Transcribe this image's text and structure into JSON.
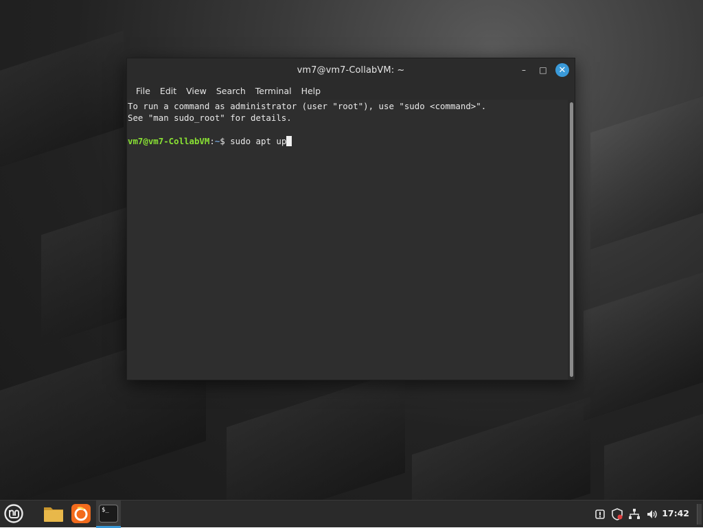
{
  "window": {
    "title": "vm7@vm7-CollabVM: ~",
    "minimize_glyph": "–",
    "maximize_glyph": "□",
    "close_glyph": "✕"
  },
  "menubar": {
    "items": [
      {
        "label": "File"
      },
      {
        "label": "Edit"
      },
      {
        "label": "View"
      },
      {
        "label": "Search"
      },
      {
        "label": "Terminal"
      },
      {
        "label": "Help"
      }
    ]
  },
  "terminal": {
    "lines": [
      "To run a command as administrator (user \"root\"), use \"sudo <command>\".",
      "See \"man sudo_root\" for details."
    ],
    "prompt_user": "vm7@vm7-CollabVM",
    "prompt_sep": ":",
    "prompt_path": "~",
    "prompt_symbol": "$ ",
    "command": "sudo apt up"
  },
  "taskbar": {
    "icons": [
      "mint-menu-icon",
      "files-folder-icon",
      "firefox-icon",
      "terminal-icon"
    ],
    "terminal_icon_text": "$_",
    "clock": "17:42",
    "colors": {
      "accent": "#3a9ad9",
      "folder": "#e8b84a",
      "firefox": "#f26b1d"
    }
  }
}
